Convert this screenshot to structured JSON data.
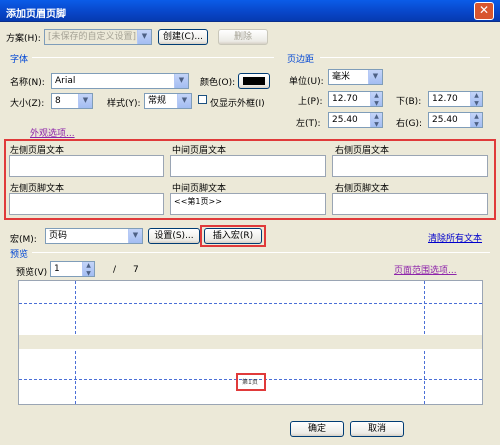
{
  "window": {
    "title": "添加页眉页脚",
    "close_icon": "close-icon"
  },
  "scheme": {
    "label": "方案(H):",
    "value": "[未保存的自定义设置]",
    "create_button": "创建(C)...",
    "delete_button": "删除"
  },
  "font": {
    "group_label": "字体",
    "name_label": "名称(N):",
    "name_value": "Arial",
    "color_label": "颜色(O):",
    "color_swatch": "#000000",
    "size_label": "大小(Z):",
    "size_value": "8",
    "style_label": "样式(Y):",
    "style_value": "常规",
    "outline_only_label": "仅显示外框(I)",
    "appearance_link": "外观选项..."
  },
  "margins": {
    "group_label": "页边距",
    "unit_label": "单位(U):",
    "unit_value": "毫米",
    "top_label": "上(P):",
    "top_value": "12.70",
    "bottom_label": "下(B):",
    "bottom_value": "12.70",
    "left_label": "左(T):",
    "left_value": "25.40",
    "right_label": "右(G):",
    "right_value": "25.40"
  },
  "header_footer": {
    "left_header_label": "左侧页眉文本",
    "center_header_label": "中间页眉文本",
    "right_header_label": "右侧页眉文本",
    "left_footer_label": "左侧页脚文本",
    "center_footer_label": "中间页脚文本",
    "center_footer_value": "<<第1页>>",
    "right_footer_label": "右侧页脚文本"
  },
  "macro": {
    "label": "宏(M):",
    "value": "页码",
    "settings_button": "设置(S)...",
    "insert_button": "插入宏(R)",
    "clear_all_link": "清除所有文本"
  },
  "preview": {
    "group_label": "预览",
    "page_label": "预览(V)",
    "page_value": "1",
    "page_separator": "/",
    "page_total": "7",
    "page_range_link": "页面范围选项...",
    "footer_text": "第1页"
  },
  "footer": {
    "ok_button": "确定",
    "cancel_button": "取消"
  },
  "accent": {
    "highlight": "#e03a3a",
    "group_title": "#0046d5"
  }
}
